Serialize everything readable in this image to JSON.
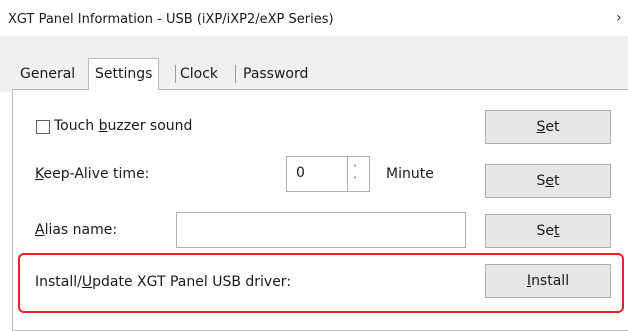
{
  "window": {
    "title": "XGT Panel Information - USB (iXP/iXP2/eXP Series)",
    "close_glyph": "›"
  },
  "tabs": [
    {
      "label": "General",
      "selected": false
    },
    {
      "label": "Settings",
      "selected": true
    },
    {
      "label": "Clock",
      "selected": false
    },
    {
      "label": "Password",
      "selected": false
    }
  ],
  "settings": {
    "touch_buzzer": {
      "label_before": "Touch ",
      "label_mnemonic": "b",
      "label_after": "uzzer sound",
      "checked": false,
      "button": {
        "before": "",
        "mnemonic": "S",
        "after": "et"
      }
    },
    "keep_alive": {
      "label_before": "",
      "label_mnemonic": "K",
      "label_after": "eep-Alive time:",
      "value": "0",
      "unit": "Minute",
      "spin_up": "˄",
      "spin_down": "˅",
      "button": {
        "before": "S",
        "mnemonic": "e",
        "after": "t"
      }
    },
    "alias": {
      "label_before": "",
      "label_mnemonic": "A",
      "label_after": "lias name:",
      "value": "",
      "button": {
        "before": "Se",
        "mnemonic": "t",
        "after": ""
      }
    },
    "usb_driver": {
      "label_before": "Install/",
      "label_mnemonic": "U",
      "label_after": "pdate XGT Panel USB driver:",
      "button": {
        "before": "",
        "mnemonic": "I",
        "after": "nstall"
      }
    }
  },
  "colors": {
    "highlight": "#e8212a",
    "button_face": "#e6e6e6",
    "tab_strip": "#f0f0f0"
  }
}
